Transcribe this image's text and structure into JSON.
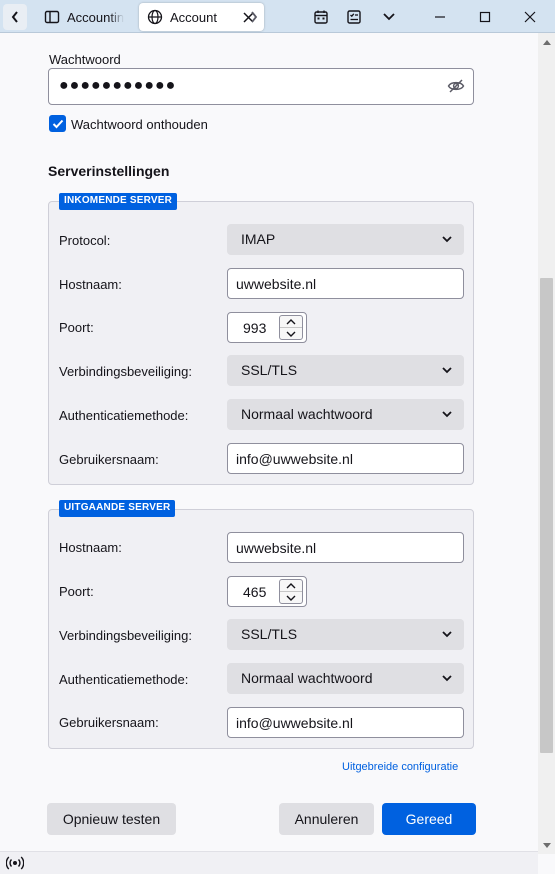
{
  "tabs": [
    {
      "title": "Accounting"
    },
    {
      "title": "Account"
    }
  ],
  "form": {
    "password_label": "Wachtwoord",
    "password_value": "●●●●●●●●●●●",
    "remember_label": "Wachtwoord onthouden",
    "remember_checked": true,
    "section_title": "Serverinstellingen"
  },
  "incoming": {
    "legend": "INKOMENDE SERVER",
    "protocol_label": "Protocol:",
    "protocol_value": "IMAP",
    "hostname_label": "Hostnaam:",
    "hostname_value": "uwwebsite.nl",
    "port_label": "Poort:",
    "port_value": "993",
    "security_label": "Verbindingsbeveiliging:",
    "security_value": "SSL/TLS",
    "auth_label": "Authenticatiemethode:",
    "auth_value": "Normaal wachtwoord",
    "username_label": "Gebruikersnaam:",
    "username_value": "info@uwwebsite.nl"
  },
  "outgoing": {
    "legend": "UITGAANDE SERVER",
    "hostname_label": "Hostnaam:",
    "hostname_value": "uwwebsite.nl",
    "port_label": "Poort:",
    "port_value": "465",
    "security_label": "Verbindingsbeveiliging:",
    "security_value": "SSL/TLS",
    "auth_label": "Authenticatiemethode:",
    "auth_value": "Normaal wachtwoord",
    "username_label": "Gebruikersnaam:",
    "username_value": "info@uwwebsite.nl"
  },
  "advanced_link": "Uitgebreide configuratie",
  "buttons": {
    "retest": "Opnieuw testen",
    "cancel": "Annuleren",
    "done": "Gereed"
  },
  "colors": {
    "accent": "#0061e0",
    "tabbar": "#d4e3f1"
  },
  "icons": [
    "back-icon",
    "account-settings-icon",
    "globe-icon",
    "close-icon",
    "chevron-right-icon",
    "calendar-icon",
    "tasks-icon",
    "chevron-down-icon",
    "minimize-icon",
    "maximize-icon",
    "window-close-icon",
    "eye-slash-icon",
    "checkmark-icon",
    "online-status-icon"
  ]
}
